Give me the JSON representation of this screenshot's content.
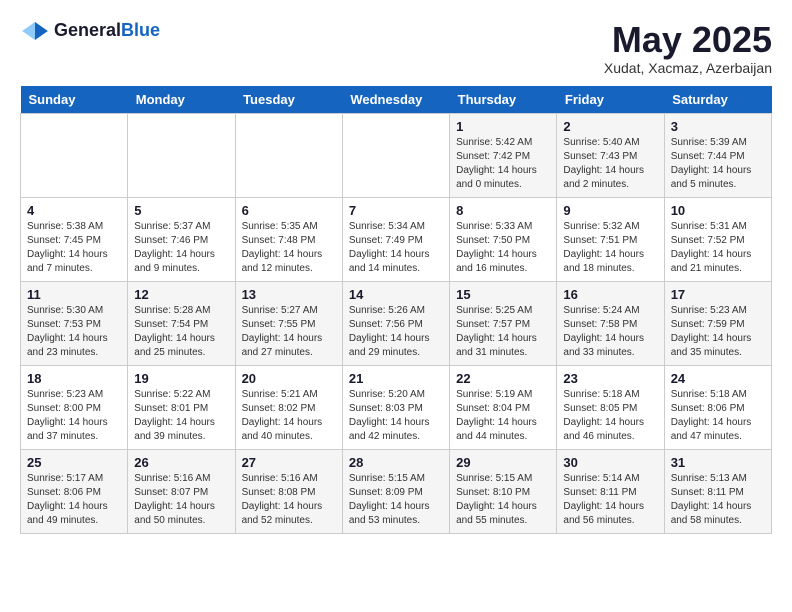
{
  "header": {
    "logo_general": "General",
    "logo_blue": "Blue",
    "month_title": "May 2025",
    "location": "Xudat, Xacmaz, Azerbaijan"
  },
  "days_of_week": [
    "Sunday",
    "Monday",
    "Tuesday",
    "Wednesday",
    "Thursday",
    "Friday",
    "Saturday"
  ],
  "weeks": [
    [
      null,
      null,
      null,
      null,
      {
        "day": "1",
        "sunrise": "Sunrise: 5:42 AM",
        "sunset": "Sunset: 7:42 PM",
        "daylight": "Daylight: 14 hours and 0 minutes."
      },
      {
        "day": "2",
        "sunrise": "Sunrise: 5:40 AM",
        "sunset": "Sunset: 7:43 PM",
        "daylight": "Daylight: 14 hours and 2 minutes."
      },
      {
        "day": "3",
        "sunrise": "Sunrise: 5:39 AM",
        "sunset": "Sunset: 7:44 PM",
        "daylight": "Daylight: 14 hours and 5 minutes."
      }
    ],
    [
      {
        "day": "4",
        "sunrise": "Sunrise: 5:38 AM",
        "sunset": "Sunset: 7:45 PM",
        "daylight": "Daylight: 14 hours and 7 minutes."
      },
      {
        "day": "5",
        "sunrise": "Sunrise: 5:37 AM",
        "sunset": "Sunset: 7:46 PM",
        "daylight": "Daylight: 14 hours and 9 minutes."
      },
      {
        "day": "6",
        "sunrise": "Sunrise: 5:35 AM",
        "sunset": "Sunset: 7:48 PM",
        "daylight": "Daylight: 14 hours and 12 minutes."
      },
      {
        "day": "7",
        "sunrise": "Sunrise: 5:34 AM",
        "sunset": "Sunset: 7:49 PM",
        "daylight": "Daylight: 14 hours and 14 minutes."
      },
      {
        "day": "8",
        "sunrise": "Sunrise: 5:33 AM",
        "sunset": "Sunset: 7:50 PM",
        "daylight": "Daylight: 14 hours and 16 minutes."
      },
      {
        "day": "9",
        "sunrise": "Sunrise: 5:32 AM",
        "sunset": "Sunset: 7:51 PM",
        "daylight": "Daylight: 14 hours and 18 minutes."
      },
      {
        "day": "10",
        "sunrise": "Sunrise: 5:31 AM",
        "sunset": "Sunset: 7:52 PM",
        "daylight": "Daylight: 14 hours and 21 minutes."
      }
    ],
    [
      {
        "day": "11",
        "sunrise": "Sunrise: 5:30 AM",
        "sunset": "Sunset: 7:53 PM",
        "daylight": "Daylight: 14 hours and 23 minutes."
      },
      {
        "day": "12",
        "sunrise": "Sunrise: 5:28 AM",
        "sunset": "Sunset: 7:54 PM",
        "daylight": "Daylight: 14 hours and 25 minutes."
      },
      {
        "day": "13",
        "sunrise": "Sunrise: 5:27 AM",
        "sunset": "Sunset: 7:55 PM",
        "daylight": "Daylight: 14 hours and 27 minutes."
      },
      {
        "day": "14",
        "sunrise": "Sunrise: 5:26 AM",
        "sunset": "Sunset: 7:56 PM",
        "daylight": "Daylight: 14 hours and 29 minutes."
      },
      {
        "day": "15",
        "sunrise": "Sunrise: 5:25 AM",
        "sunset": "Sunset: 7:57 PM",
        "daylight": "Daylight: 14 hours and 31 minutes."
      },
      {
        "day": "16",
        "sunrise": "Sunrise: 5:24 AM",
        "sunset": "Sunset: 7:58 PM",
        "daylight": "Daylight: 14 hours and 33 minutes."
      },
      {
        "day": "17",
        "sunrise": "Sunrise: 5:23 AM",
        "sunset": "Sunset: 7:59 PM",
        "daylight": "Daylight: 14 hours and 35 minutes."
      }
    ],
    [
      {
        "day": "18",
        "sunrise": "Sunrise: 5:23 AM",
        "sunset": "Sunset: 8:00 PM",
        "daylight": "Daylight: 14 hours and 37 minutes."
      },
      {
        "day": "19",
        "sunrise": "Sunrise: 5:22 AM",
        "sunset": "Sunset: 8:01 PM",
        "daylight": "Daylight: 14 hours and 39 minutes."
      },
      {
        "day": "20",
        "sunrise": "Sunrise: 5:21 AM",
        "sunset": "Sunset: 8:02 PM",
        "daylight": "Daylight: 14 hours and 40 minutes."
      },
      {
        "day": "21",
        "sunrise": "Sunrise: 5:20 AM",
        "sunset": "Sunset: 8:03 PM",
        "daylight": "Daylight: 14 hours and 42 minutes."
      },
      {
        "day": "22",
        "sunrise": "Sunrise: 5:19 AM",
        "sunset": "Sunset: 8:04 PM",
        "daylight": "Daylight: 14 hours and 44 minutes."
      },
      {
        "day": "23",
        "sunrise": "Sunrise: 5:18 AM",
        "sunset": "Sunset: 8:05 PM",
        "daylight": "Daylight: 14 hours and 46 minutes."
      },
      {
        "day": "24",
        "sunrise": "Sunrise: 5:18 AM",
        "sunset": "Sunset: 8:06 PM",
        "daylight": "Daylight: 14 hours and 47 minutes."
      }
    ],
    [
      {
        "day": "25",
        "sunrise": "Sunrise: 5:17 AM",
        "sunset": "Sunset: 8:06 PM",
        "daylight": "Daylight: 14 hours and 49 minutes."
      },
      {
        "day": "26",
        "sunrise": "Sunrise: 5:16 AM",
        "sunset": "Sunset: 8:07 PM",
        "daylight": "Daylight: 14 hours and 50 minutes."
      },
      {
        "day": "27",
        "sunrise": "Sunrise: 5:16 AM",
        "sunset": "Sunset: 8:08 PM",
        "daylight": "Daylight: 14 hours and 52 minutes."
      },
      {
        "day": "28",
        "sunrise": "Sunrise: 5:15 AM",
        "sunset": "Sunset: 8:09 PM",
        "daylight": "Daylight: 14 hours and 53 minutes."
      },
      {
        "day": "29",
        "sunrise": "Sunrise: 5:15 AM",
        "sunset": "Sunset: 8:10 PM",
        "daylight": "Daylight: 14 hours and 55 minutes."
      },
      {
        "day": "30",
        "sunrise": "Sunrise: 5:14 AM",
        "sunset": "Sunset: 8:11 PM",
        "daylight": "Daylight: 14 hours and 56 minutes."
      },
      {
        "day": "31",
        "sunrise": "Sunrise: 5:13 AM",
        "sunset": "Sunset: 8:11 PM",
        "daylight": "Daylight: 14 hours and 58 minutes."
      }
    ]
  ]
}
